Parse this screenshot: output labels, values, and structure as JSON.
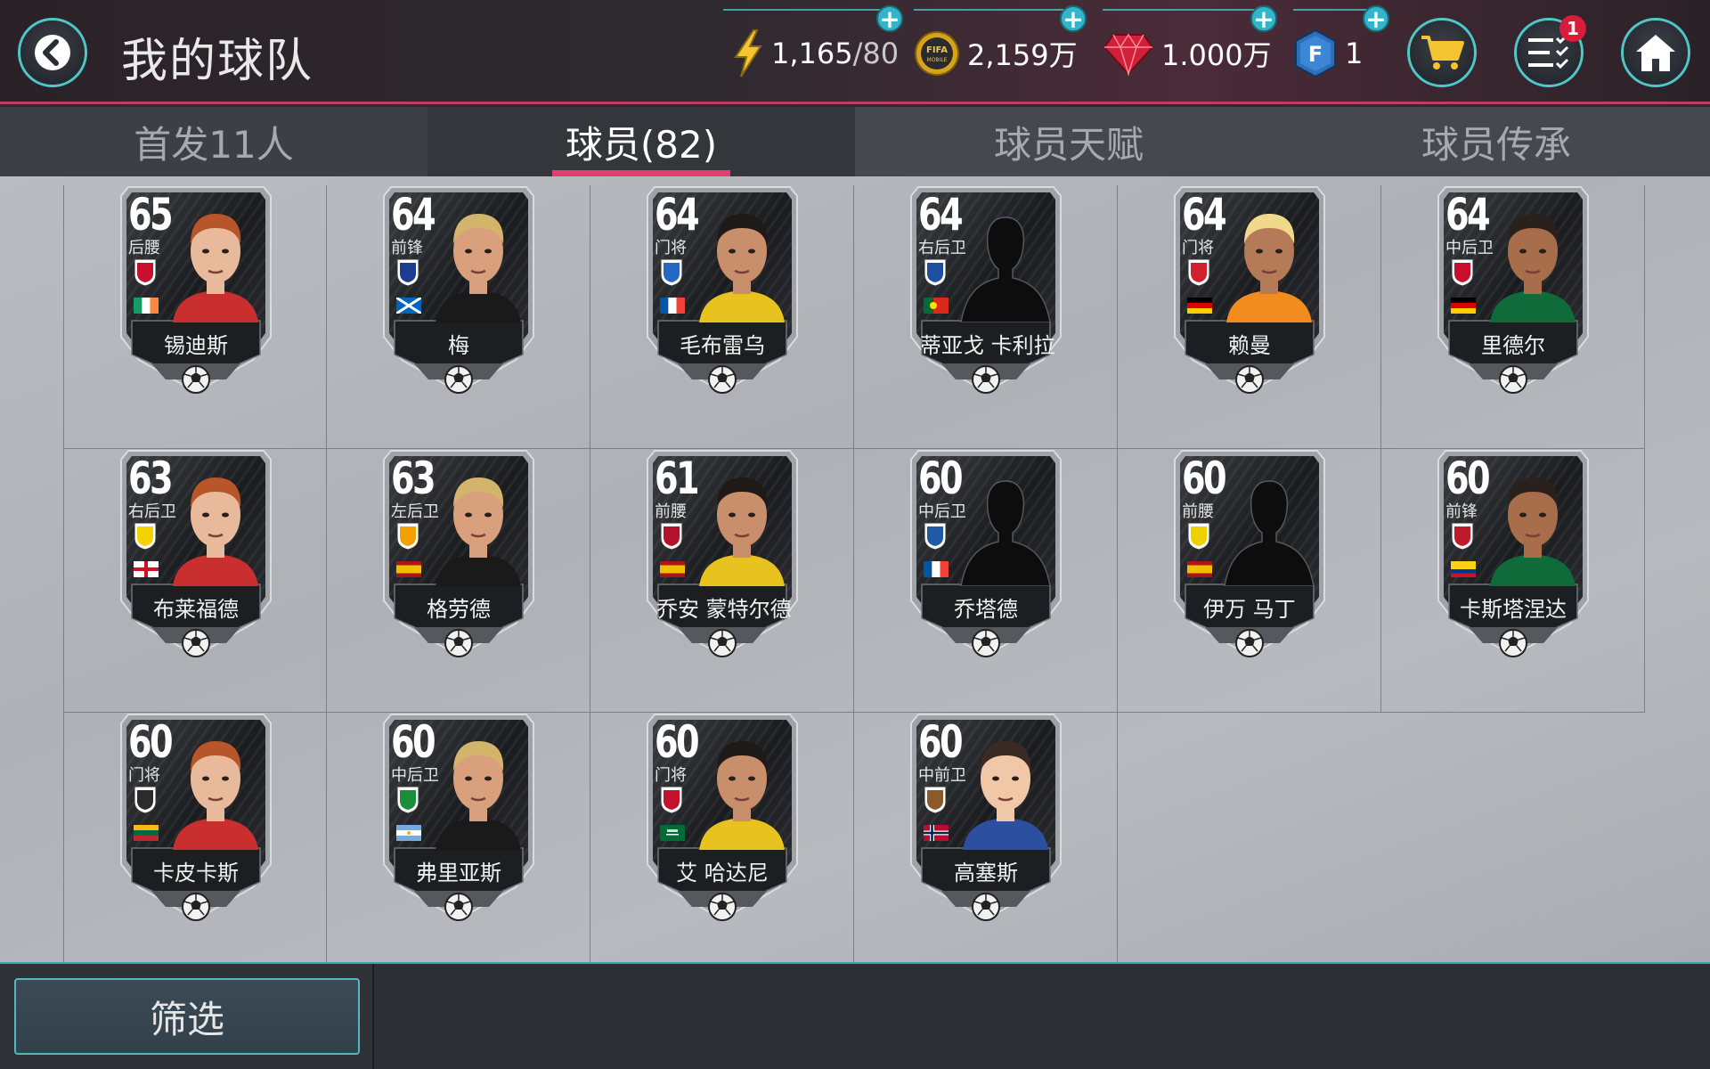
{
  "header": {
    "title": "我的球队",
    "resources": [
      {
        "id": "energy",
        "icon": "lightning-icon",
        "value": "1,165",
        "suffix": "/80"
      },
      {
        "id": "coins",
        "icon": "fifa-coin-icon",
        "value": "2,159万",
        "suffix": ""
      },
      {
        "id": "gems",
        "icon": "gem-icon",
        "value": "1.000万",
        "suffix": ""
      },
      {
        "id": "fifa-points",
        "icon": "fifa-points-icon",
        "value": "1",
        "suffix": ""
      }
    ],
    "coin_icon_text": "FIFA\nMOBILE",
    "fifa_points_icon_text": "F",
    "notification_count": "1"
  },
  "tabs": [
    {
      "label": "首发11人",
      "active": false
    },
    {
      "label": "球员(82)",
      "active": true
    },
    {
      "label": "球员天赋",
      "active": false
    },
    {
      "label": "球员传承",
      "active": false
    }
  ],
  "players": [
    {
      "rating": "65",
      "position": "后腰",
      "name": "锡迪斯",
      "flag": "ireland",
      "silhouette": false
    },
    {
      "rating": "64",
      "position": "前锋",
      "name": "梅",
      "flag": "scotland",
      "silhouette": false
    },
    {
      "rating": "64",
      "position": "门将",
      "name": "毛布雷乌",
      "flag": "france",
      "silhouette": false
    },
    {
      "rating": "64",
      "position": "右后卫",
      "name": "蒂亚戈 卡利拉",
      "flag": "portugal",
      "silhouette": true
    },
    {
      "rating": "64",
      "position": "门将",
      "name": "赖曼",
      "flag": "germany",
      "silhouette": false
    },
    {
      "rating": "64",
      "position": "中后卫",
      "name": "里德尔",
      "flag": "germany",
      "silhouette": false
    },
    {
      "rating": "63",
      "position": "右后卫",
      "name": "布莱福德",
      "flag": "england",
      "silhouette": false
    },
    {
      "rating": "63",
      "position": "左后卫",
      "name": "格劳德",
      "flag": "spain",
      "silhouette": false
    },
    {
      "rating": "61",
      "position": "前腰",
      "name": "乔安 蒙特尔德",
      "flag": "spain",
      "silhouette": false
    },
    {
      "rating": "60",
      "position": "中后卫",
      "name": "乔塔德",
      "flag": "france",
      "silhouette": true
    },
    {
      "rating": "60",
      "position": "前腰",
      "name": "伊万 马丁",
      "flag": "spain",
      "silhouette": true
    },
    {
      "rating": "60",
      "position": "前锋",
      "name": "卡斯塔涅达",
      "flag": "colombia",
      "silhouette": false
    },
    {
      "rating": "60",
      "position": "门将",
      "name": "卡皮卡斯",
      "flag": "lithuania",
      "silhouette": false
    },
    {
      "rating": "60",
      "position": "中后卫",
      "name": "弗里亚斯",
      "flag": "argentina",
      "silhouette": false
    },
    {
      "rating": "60",
      "position": "门将",
      "name": "艾 哈达尼",
      "flag": "saudi-arabia",
      "silhouette": false
    },
    {
      "rating": "60",
      "position": "中前卫",
      "name": "高塞斯",
      "flag": "norway",
      "silhouette": false
    }
  ],
  "bottom": {
    "filter_label": "筛选"
  },
  "colors": {
    "accent": "#4fc7c9",
    "tab_underline": "#e23f6f",
    "header_border": "#c23b67"
  }
}
